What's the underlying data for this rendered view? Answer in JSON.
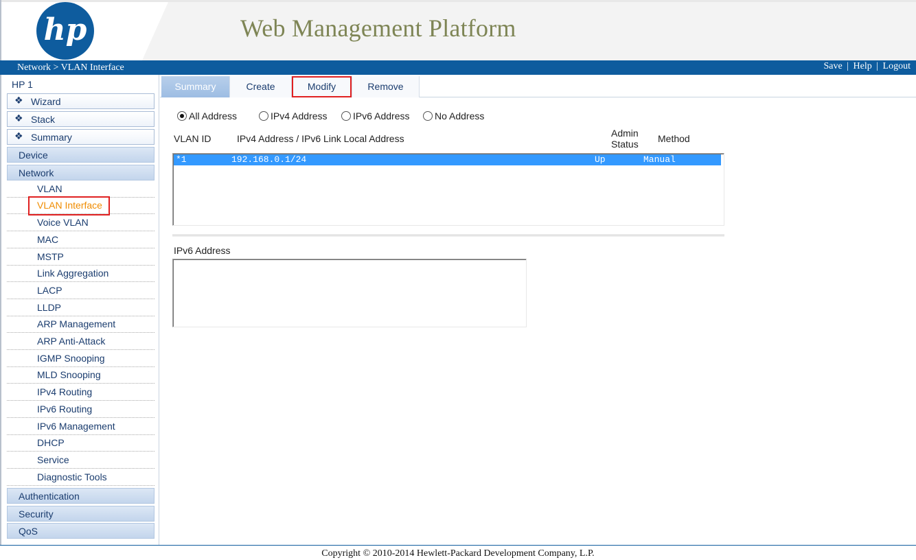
{
  "header": {
    "logo_text": "hp",
    "title": "Web Management Platform",
    "colors": {
      "title": "#7e8555",
      "logo": "#0e5c9e",
      "bar": "#0e5c9e"
    }
  },
  "navbar": {
    "breadcrumb": "Network > VLAN Interface",
    "links": {
      "save": "Save",
      "help": "Help",
      "logout": "Logout",
      "separator": "|"
    }
  },
  "sidebar": {
    "device": "HP 1",
    "quick_items": [
      {
        "label": "Wizard",
        "icon": "diamond-bullet-icon"
      },
      {
        "label": "Stack",
        "icon": "diamond-bullet-icon"
      },
      {
        "label": "Summary",
        "icon": "diamond-bullet-icon"
      }
    ],
    "sections": {
      "device": "Device",
      "network": "Network",
      "authentication": "Authentication",
      "security": "Security",
      "qos": "QoS"
    },
    "network_items": [
      {
        "label": "VLAN"
      },
      {
        "label": "VLAN Interface",
        "active": true
      },
      {
        "label": "Voice VLAN"
      },
      {
        "label": "MAC"
      },
      {
        "label": "MSTP"
      },
      {
        "label": "Link Aggregation"
      },
      {
        "label": "LACP"
      },
      {
        "label": "LLDP"
      },
      {
        "label": "ARP Management"
      },
      {
        "label": "ARP Anti-Attack"
      },
      {
        "label": "IGMP Snooping"
      },
      {
        "label": "MLD Snooping"
      },
      {
        "label": "IPv4 Routing"
      },
      {
        "label": "IPv6 Routing"
      },
      {
        "label": "IPv6 Management"
      },
      {
        "label": "DHCP"
      },
      {
        "label": "Service"
      },
      {
        "label": "Diagnostic Tools"
      }
    ]
  },
  "tabs": [
    {
      "label": "Summary",
      "active": true
    },
    {
      "label": "Create"
    },
    {
      "label": "Modify",
      "highlighted": true
    },
    {
      "label": "Remove"
    }
  ],
  "filter": {
    "options": [
      {
        "label": "All Address",
        "selected": true
      },
      {
        "label": "IPv4 Address"
      },
      {
        "label": "IPv6 Address"
      },
      {
        "label": "No Address"
      }
    ]
  },
  "vlan_table": {
    "columns": {
      "vlan_id": "VLAN ID",
      "address": "IPv4 Address / IPv6 Link Local Address",
      "admin_status_1": "Admin",
      "admin_status_2": "Status",
      "method": "Method"
    },
    "rows": [
      {
        "vlan_id": "*1",
        "address": "192.168.0.1/24",
        "status": "Up",
        "method": "Manual",
        "selected": true
      }
    ]
  },
  "ipv6": {
    "label": "IPv6 Address",
    "items": []
  },
  "footer": {
    "copyright": "Copyright © 2010-2014 Hewlett-Packard Development Company, L.P."
  }
}
